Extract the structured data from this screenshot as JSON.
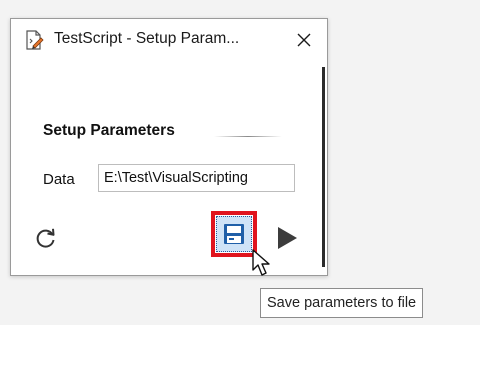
{
  "window": {
    "title": "TestScript - Setup Param...",
    "close_glyph": "✕"
  },
  "section": {
    "title": "Setup Parameters"
  },
  "data_field": {
    "label": "Data",
    "value": "E:\\Test\\VisualScripting"
  },
  "toolbar": {
    "refresh_icon": "refresh-icon",
    "save_icon": "save-icon",
    "run_icon": "play-icon"
  },
  "tooltip": {
    "text": "Save parameters to file"
  },
  "colors": {
    "highlight": "#e0141e",
    "save_accent": "#1f5fa8",
    "save_bg": "#cfe3f7",
    "run_icon": "#3c3c3c"
  }
}
